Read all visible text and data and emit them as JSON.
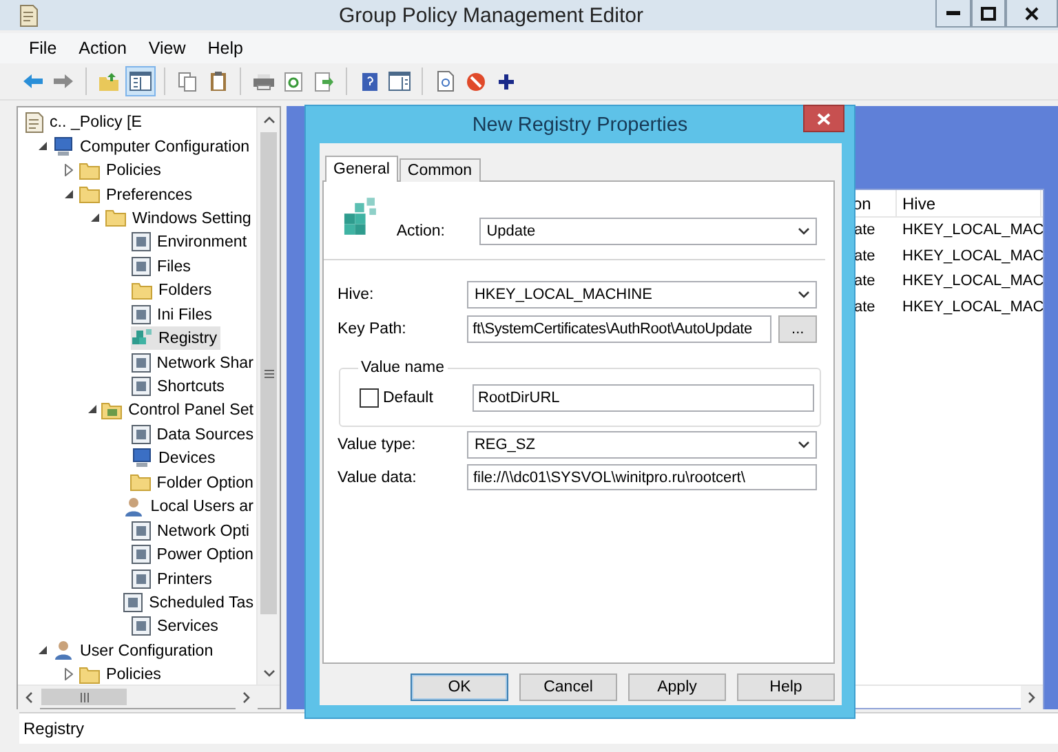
{
  "window": {
    "title": "Group Policy Management Editor"
  },
  "menu": [
    "File",
    "Action",
    "View",
    "Help"
  ],
  "toolbar": [
    {
      "kind": "back",
      "pressed": false
    },
    {
      "kind": "forward",
      "pressed": false
    },
    {
      "kind": "separator"
    },
    {
      "kind": "folder_up",
      "pressed": false
    },
    {
      "kind": "console_tree",
      "pressed": true
    },
    {
      "kind": "separator"
    },
    {
      "kind": "copy",
      "pressed": false
    },
    {
      "kind": "paste",
      "pressed": false
    },
    {
      "kind": "separator"
    },
    {
      "kind": "print",
      "pressed": false
    },
    {
      "kind": "refresh",
      "pressed": false
    },
    {
      "kind": "export",
      "pressed": false
    },
    {
      "kind": "separator"
    },
    {
      "kind": "help",
      "pressed": false
    },
    {
      "kind": "pane",
      "pressed": false
    },
    {
      "kind": "separator"
    },
    {
      "kind": "doc",
      "pressed": false
    },
    {
      "kind": "stop",
      "pressed": false
    },
    {
      "kind": "add",
      "pressed": false
    }
  ],
  "tree": {
    "label": "c..      _Policy [E",
    "kind": "doc",
    "selected": false,
    "children": [
      {
        "label": "Computer Configuration",
        "kind": "computer",
        "selected": false,
        "expanded": true,
        "children": [
          {
            "label": "Policies",
            "kind": "folder",
            "selected": false,
            "expanded": false
          },
          {
            "label": "Preferences",
            "kind": "folder",
            "selected": false,
            "expanded": true,
            "children": [
              {
                "label": "Windows Setting",
                "kind": "folder",
                "selected": false,
                "expanded": true,
                "children": [
                  {
                    "label": "Environment",
                    "kind": "item",
                    "selected": false
                  },
                  {
                    "label": "Files",
                    "kind": "item",
                    "selected": false
                  },
                  {
                    "label": "Folders",
                    "kind": "folder",
                    "selected": false
                  },
                  {
                    "label": "Ini Files",
                    "kind": "item",
                    "selected": false
                  },
                  {
                    "label": "Registry",
                    "kind": "registry",
                    "selected": true
                  },
                  {
                    "label": "Network Shar",
                    "kind": "item",
                    "selected": false
                  },
                  {
                    "label": "Shortcuts",
                    "kind": "item",
                    "selected": false
                  }
                ]
              },
              {
                "label": "Control Panel Set",
                "kind": "panel",
                "selected": false,
                "expanded": true,
                "children": [
                  {
                    "label": "Data Sources",
                    "kind": "item",
                    "selected": false
                  },
                  {
                    "label": "Devices",
                    "kind": "computer",
                    "selected": false
                  },
                  {
                    "label": "Folder Option",
                    "kind": "folder",
                    "selected": false
                  },
                  {
                    "label": "Local Users ar",
                    "kind": "user",
                    "selected": false
                  },
                  {
                    "label": "Network Opti",
                    "kind": "item",
                    "selected": false
                  },
                  {
                    "label": "Power Option",
                    "kind": "item",
                    "selected": false
                  },
                  {
                    "label": "Printers",
                    "kind": "item",
                    "selected": false
                  },
                  {
                    "label": "Scheduled Tas",
                    "kind": "item",
                    "selected": false
                  },
                  {
                    "label": "Services",
                    "kind": "item",
                    "selected": false
                  }
                ]
              }
            ]
          }
        ]
      },
      {
        "label": "User Configuration",
        "kind": "user",
        "selected": false,
        "expanded": true,
        "children": [
          {
            "label": "Policies",
            "kind": "folder",
            "selected": false,
            "expanded": false
          }
        ]
      }
    ]
  },
  "details_list": {
    "columns": [
      "on",
      "Hive"
    ],
    "rows": [
      [
        "ate",
        "HKEY_LOCAL_MAC"
      ],
      [
        "ate",
        "HKEY_LOCAL_MAC"
      ],
      [
        "ate",
        "HKEY_LOCAL_MAC"
      ],
      [
        "ate",
        "HKEY_LOCAL_MAC"
      ]
    ]
  },
  "dialog": {
    "title": "New Registry Properties",
    "tabs": [
      {
        "label": "General",
        "selected": true
      },
      {
        "label": "Common",
        "selected": false
      }
    ],
    "action": {
      "label": "Action:",
      "value": "Update"
    },
    "hive": {
      "label": "Hive:",
      "value": "HKEY_LOCAL_MACHINE"
    },
    "key_path": {
      "label": "Key Path:",
      "value": "ft\\SystemCertificates\\AuthRoot\\AutoUpdate",
      "browse": "..."
    },
    "value_name": {
      "title": "Value name",
      "default": {
        "label": "Default",
        "checked": false
      },
      "value": "RootDirURL"
    },
    "value_type": {
      "label": "Value type:",
      "value": "REG_SZ"
    },
    "value_data": {
      "label": "Value data:",
      "value": "file://\\\\dc01\\SYSVOL\\winitpro.ru\\rootcert\\"
    },
    "buttons": [
      {
        "label": "OK",
        "default": true
      },
      {
        "label": "Cancel",
        "default": false
      },
      {
        "label": "Apply",
        "default": false
      },
      {
        "label": "Help",
        "default": false
      }
    ]
  },
  "status_bar": "Registry"
}
